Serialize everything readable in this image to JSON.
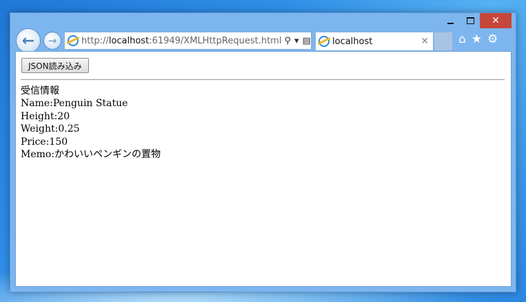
{
  "browser": {
    "url_scheme": "http://",
    "url_host": "localhost",
    "url_rest": ":61949/XMLHttpRequest.html",
    "tab_title": "localhost",
    "close_glyph": "✕"
  },
  "page": {
    "button_label": "JSON読み込み",
    "heading": "受信情報",
    "fields": [
      "Name:Penguin Statue",
      "Height:20",
      "Weight:0.25",
      "Price:150",
      "Memo:かわいいペンギンの置物"
    ]
  },
  "icons": {
    "back": "arrow-left-icon",
    "forward": "arrow-right-icon",
    "search": "search-icon",
    "refresh": "refresh-icon",
    "home": "home-icon",
    "favorites": "star-icon",
    "tools": "gear-icon"
  }
}
